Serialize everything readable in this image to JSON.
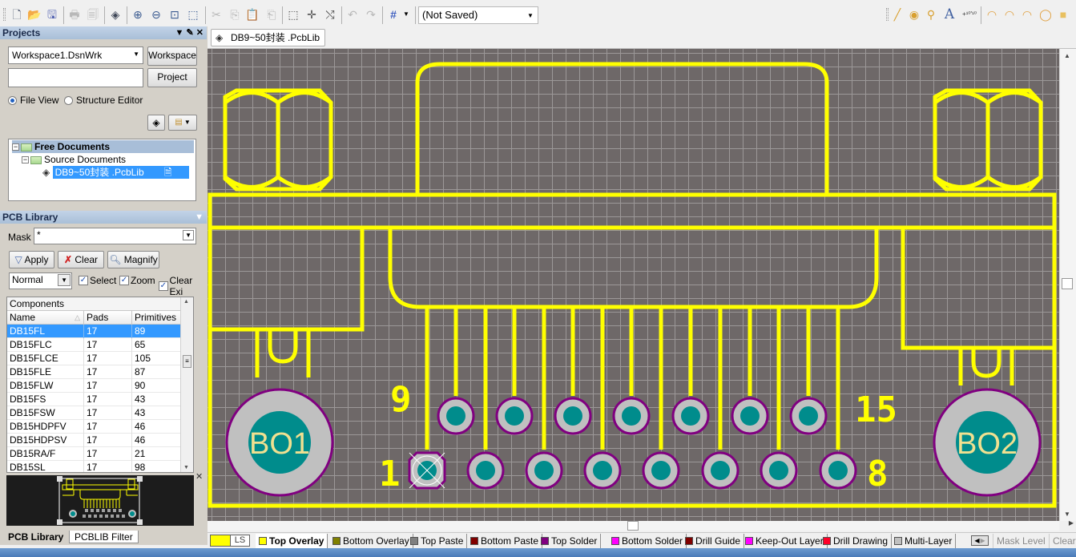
{
  "toolbar": {
    "buttons": [
      {
        "name": "new-document",
        "icon": "📄",
        "enabled": true
      },
      {
        "name": "open-document",
        "icon": "📂",
        "enabled": true
      },
      {
        "name": "save",
        "icon": "💾",
        "enabled": true
      },
      {
        "name": "print",
        "icon": "🖶",
        "enabled": false
      },
      {
        "name": "print-preview",
        "icon": "🔍",
        "enabled": false
      },
      {
        "name": "open-layer-stack",
        "icon": "◈",
        "enabled": true
      },
      {
        "name": "zoom-in",
        "icon": "⊕",
        "enabled": true
      },
      {
        "name": "zoom-out",
        "icon": "⊖",
        "enabled": true
      },
      {
        "name": "fit-document",
        "icon": "⊡",
        "enabled": true
      },
      {
        "name": "zoom-area",
        "icon": "⬚",
        "enabled": true
      },
      {
        "name": "cut",
        "icon": "✂",
        "enabled": false
      },
      {
        "name": "copy",
        "icon": "⎘",
        "enabled": false
      },
      {
        "name": "paste",
        "icon": "📋",
        "enabled": true
      },
      {
        "name": "rubber-stamp",
        "icon": "⎗",
        "enabled": false
      },
      {
        "name": "select-area",
        "icon": "⬚",
        "enabled": true
      },
      {
        "name": "move-selection",
        "icon": "✛",
        "enabled": true
      },
      {
        "name": "deselect",
        "icon": "⤭",
        "enabled": true
      },
      {
        "name": "undo",
        "icon": "↶",
        "enabled": false
      },
      {
        "name": "redo",
        "icon": "↷",
        "enabled": false
      },
      {
        "name": "grid",
        "icon": "#",
        "enabled": true
      }
    ],
    "variant_combo": "(Not Saved)",
    "place_tools": [
      {
        "name": "place-line",
        "icon": "╱"
      },
      {
        "name": "place-pad",
        "icon": "◉"
      },
      {
        "name": "place-via",
        "icon": "⚲"
      },
      {
        "name": "place-string",
        "icon": "A"
      },
      {
        "name": "place-coordinate",
        "icon": "+¹⁰'¹⁰"
      },
      {
        "name": "arc-center",
        "icon": "◠"
      },
      {
        "name": "arc-edge",
        "icon": "◠"
      },
      {
        "name": "arc-any-angle",
        "icon": "◠"
      },
      {
        "name": "full-circle",
        "icon": "◯"
      },
      {
        "name": "place-fill",
        "icon": "■"
      }
    ]
  },
  "projects_panel": {
    "title": "Projects",
    "workspace_value": "Workspace1.DsnWrk",
    "workspace_button": "Workspace",
    "project_value": "",
    "project_button": "Project",
    "radio_file_view": "File View",
    "radio_structure_editor": "Structure Editor",
    "selected_view": "File View",
    "tree": {
      "root": "Free Documents",
      "child": "Source Documents",
      "leaf": "DB9~50封装 .PcbLib"
    }
  },
  "pcb_library_panel": {
    "title": "PCB Library",
    "mask_label": "Mask",
    "mask_value": "*",
    "apply_label": "Apply",
    "clear_label": "Clear",
    "magnify_label": "Magnify",
    "mode_value": "Normal",
    "check_select": "Select",
    "check_zoom": "Zoom",
    "check_clear": "Clear Exi",
    "components_title": "Components",
    "columns": [
      "Name",
      "Pads",
      "Primitives"
    ],
    "rows": [
      {
        "name": "DB15FL",
        "pads": "17",
        "primitives": "89",
        "selected": true
      },
      {
        "name": "DB15FLC",
        "pads": "17",
        "primitives": "65"
      },
      {
        "name": "DB15FLCE",
        "pads": "17",
        "primitives": "105"
      },
      {
        "name": "DB15FLE",
        "pads": "17",
        "primitives": "87"
      },
      {
        "name": "DB15FLW",
        "pads": "17",
        "primitives": "90"
      },
      {
        "name": "DB15FS",
        "pads": "17",
        "primitives": "43"
      },
      {
        "name": "DB15FSW",
        "pads": "17",
        "primitives": "43"
      },
      {
        "name": "DB15HDPFV",
        "pads": "17",
        "primitives": "46"
      },
      {
        "name": "DB15HDPSV",
        "pads": "17",
        "primitives": "46"
      },
      {
        "name": "DB15RA/F",
        "pads": "17",
        "primitives": "21"
      },
      {
        "name": "DB15SL",
        "pads": "17",
        "primitives": "98"
      }
    ]
  },
  "panel_tabs": [
    "PCB Library",
    "PCBLIB Filter"
  ],
  "document_tab": "DB9~50封装 .PcbLib",
  "footprint": {
    "pin_labels": {
      "top_left": "9",
      "top_right": "15",
      "bottom_left": "1",
      "bottom_right": "8"
    },
    "mount_hole_left": "BO1",
    "mount_hole_right": "BO2",
    "colors": {
      "overlay": "#ffff00",
      "pad_ring": "#c0c0c0",
      "pad_hole": "#008c8c",
      "pad_outline": "#800080",
      "mount_text": "#f0e090",
      "canvas_bg": "#6e6868",
      "grid": "#9c9898"
    }
  },
  "layer_bar": {
    "current_layer_code": "LS",
    "current_color": "#ffff00",
    "layers": [
      {
        "label": "Top Overlay",
        "color": "#ffff00",
        "active": true
      },
      {
        "label": "Bottom Overlay",
        "color": "#808000"
      },
      {
        "label": "Top Paste",
        "color": "#808080"
      },
      {
        "label": "Bottom Paste",
        "color": "#800000"
      },
      {
        "label": "Top Solder",
        "color": "#800080"
      },
      {
        "label": "Bottom Solder",
        "color": "#ff00ff"
      },
      {
        "label": "Drill Guide",
        "color": "#800000"
      },
      {
        "label": "Keep-Out Layer",
        "color": "#ff00ff"
      },
      {
        "label": "Drill Drawing",
        "color": "#ff0028"
      },
      {
        "label": "Multi-Layer",
        "color": "#c0c0c0"
      }
    ],
    "mask_level": "Mask Level",
    "clear": "Clear"
  }
}
